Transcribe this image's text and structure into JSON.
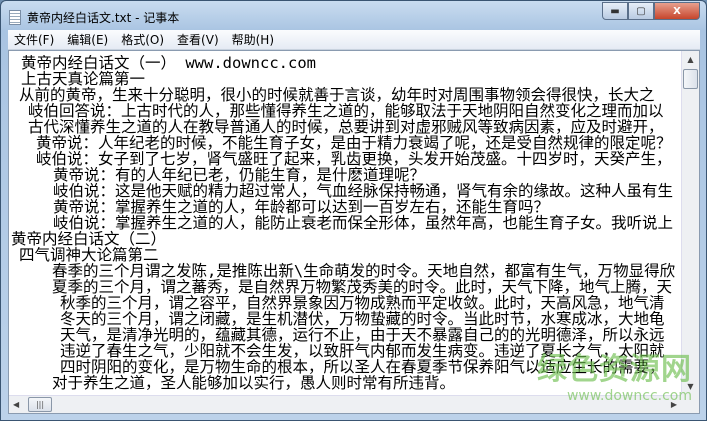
{
  "window": {
    "title": "黄帝内经白话文.txt - 记事本",
    "min": "▬",
    "max": "▢",
    "close": "X"
  },
  "menu": [
    "文件(F)",
    "编辑(E)",
    "格式(O)",
    "查看(V)",
    "帮助(H)"
  ],
  "lines": [
    {
      "t": "黄帝内经白话文（一） www.downcc.com",
      "i": 12
    },
    {
      "t": "上古天真论篇第一",
      "i": 12
    },
    {
      "t": "从前的黄帝，生来十分聪明，很小的时候就善于言谈，幼年时对周围事物领会得很快，长大之",
      "i": 10
    },
    {
      "t": "岐伯回答说：上古时代的人，那些懂得养生之道的，能够取法于天地阴阳自然变化之理而加以",
      "i": 19
    },
    {
      "t": "古代深懂养生之道的人在教导普通人的时候，总要讲到对虚邪贼风等致病因素，应及时避开，",
      "i": 19
    },
    {
      "t": "黄帝说：人年纪老的时候，不能生育子女，是由于精力衰竭了呢，还是受自然规律的限定呢？",
      "i": 27
    },
    {
      "t": "岐伯说：女子到了七岁，肾气盛旺了起来，乳齿更换，头发开始茂盛。十四岁时，天癸产生，",
      "i": 27
    },
    {
      "t": "黄帝说：有的人年纪已老，仍能生育，是什麽道理呢？",
      "i": 44
    },
    {
      "t": "岐伯说：这是他天赋的精力超过常人，气血经脉保持畅通，肾气有余的缘故。这种人虽有生",
      "i": 44
    },
    {
      "t": "黄帝说：掌握养生之道的人，年龄都可以达到一百岁左右，还能生育吗？",
      "i": 44
    },
    {
      "t": "岐伯说：掌握养生之道的人，能防止衰老而保全形体，虽然年高，也能生育子女。我听说上",
      "i": 44
    },
    {
      "t": "黄帝内经白话文（二）",
      "i": 2
    },
    {
      "t": "四气调神大论篇第二",
      "i": 10
    },
    {
      "t": "春季的三个月谓之发陈,是推陈出新\\生命萌发的时令。天地自然，都富有生气，万物显得欣",
      "i": 43
    },
    {
      "t": "夏季的三个月，谓之蕃秀，是自然界万物繁茂秀美的时令。此时，天气下降，地气上腾，天",
      "i": 43
    },
    {
      "t": "秋季的三个月，谓之容平，自然界景象因万物成熟而平定收敛。此时，天高风急，地气清",
      "i": 51
    },
    {
      "t": "冬天的三个月，谓之闭藏，是生机潜伏，万物蛰藏的时令。当此时节，水寒成冰，大地龟",
      "i": 51
    },
    {
      "t": "天气，是清净光明的，蕴藏其德，运行不止，由于天不暴露自己的的光明德泽，所以永远",
      "i": 51
    },
    {
      "t": "违逆了春生之气，少阳就不会生发，以致肝气内郁而发生病变。违逆了夏长之气，太阳就",
      "i": 51
    },
    {
      "t": "四时阴阳的变化，是万物生命的根本，所以圣人在春夏季节保养阳气以适应生长的需要，",
      "i": 51
    },
    {
      "t": "对于养生之道，圣人能够加以实行，愚人则时常有所违背。",
      "i": 43
    }
  ],
  "watermark": {
    "cn": "绿色资源网",
    "url": "www.downcc.com"
  }
}
